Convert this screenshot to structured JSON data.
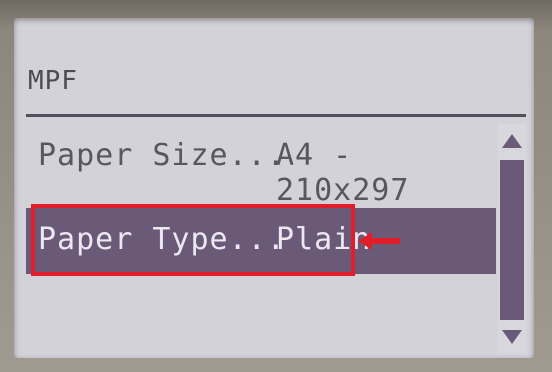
{
  "header": {
    "title": "MPF"
  },
  "menu": {
    "items": [
      {
        "label": "Paper Size...",
        "value": "A4 - 210x297"
      },
      {
        "label": "Paper Type...",
        "value": "Plain"
      }
    ],
    "selected_index": 1
  },
  "icons": {
    "annotation_arrow": "left-arrow-icon",
    "scroll_up": "triangle-up-icon",
    "scroll_down": "triangle-down-icon"
  },
  "colors": {
    "lcd_background": "#d3d2d9",
    "selection": "#6a5a78",
    "annotation": "#e01e2a"
  }
}
